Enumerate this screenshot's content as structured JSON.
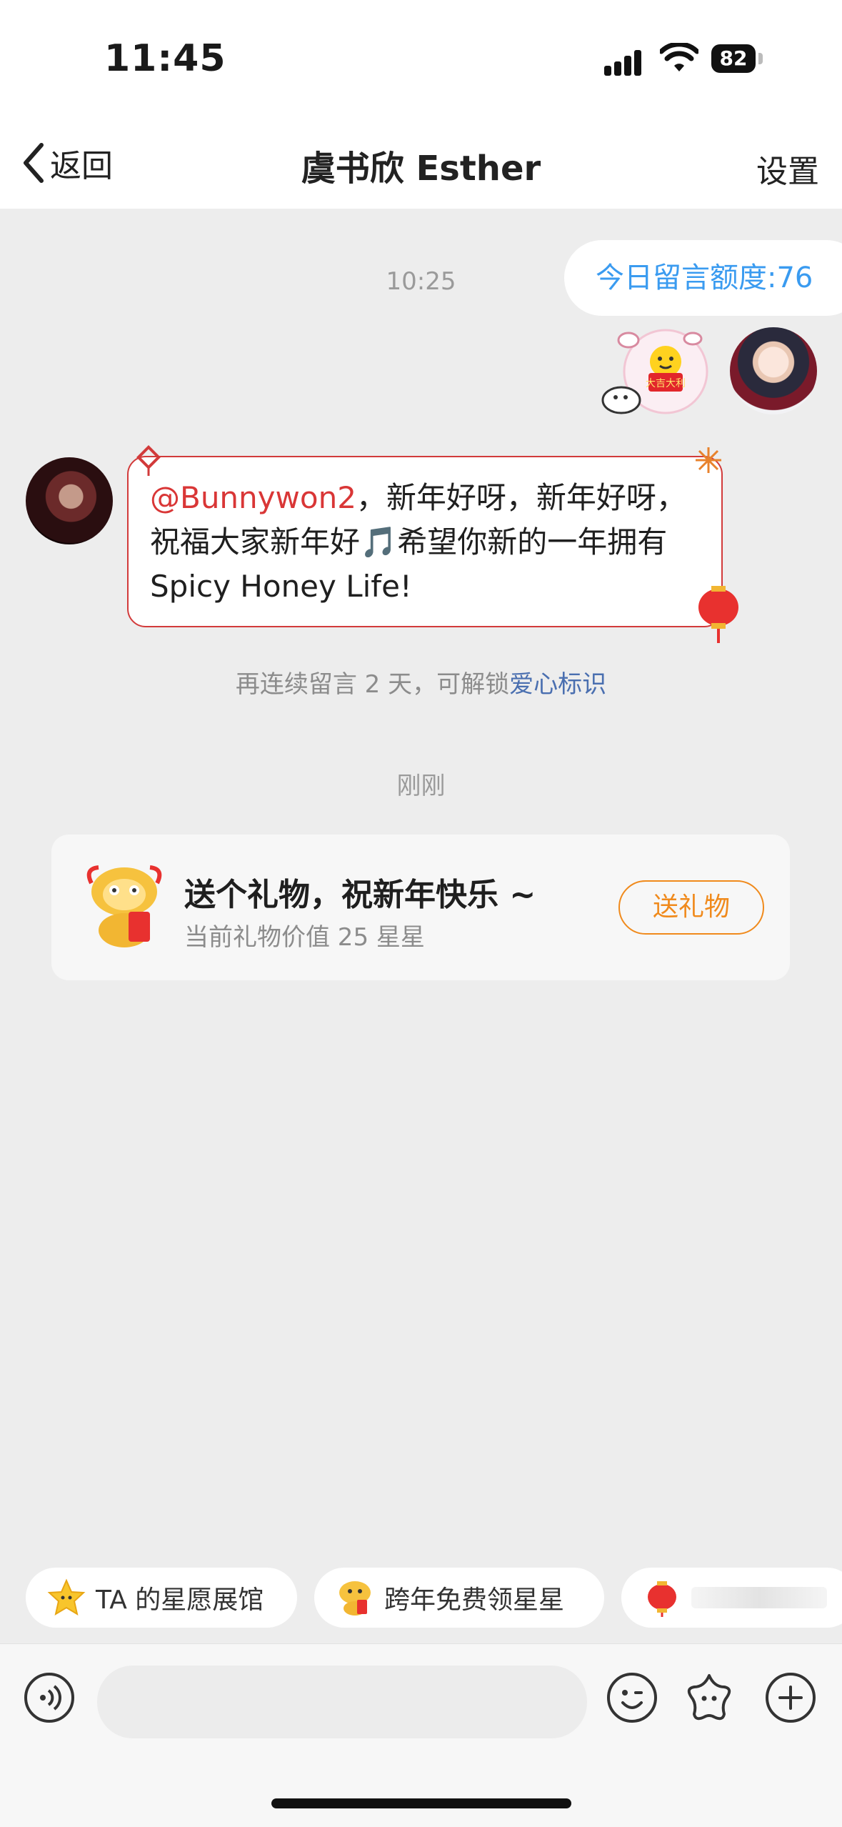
{
  "status_bar": {
    "time": "11:45",
    "battery": "82"
  },
  "nav": {
    "back_label": "返回",
    "title": "虞书欣 Esther",
    "settings_label": "设置"
  },
  "chat": {
    "timestamp_1": "10:25",
    "quota_label": "今日留言额度:76",
    "message": {
      "mention": "@Bunnywon2",
      "text": "，新年好呀，新年好呀，祝福大家新年好🎵希望你新的一年拥有 Spicy Honey Life!"
    },
    "streak_hint": {
      "prefix": "再连续留言 2 天，可解锁",
      "link": "爱心标识"
    },
    "sticker_text": "大吉大利",
    "timestamp_2": "刚刚"
  },
  "gift_card": {
    "title": "送个礼物，祝新年快乐 ~",
    "subtitle": "当前礼物价值 25 星星",
    "button_label": "送礼物"
  },
  "quick_chips": [
    {
      "label": "TA 的星愿展馆",
      "icon": "star-face-icon"
    },
    {
      "label": "跨年免费领星星",
      "icon": "lion-dance-icon"
    },
    {
      "label": "",
      "icon": "lantern-icon"
    }
  ],
  "input_bar": {
    "voice_icon": "voice-icon",
    "emoji_icon": "emoji-icon",
    "star_icon": "star-gift-icon",
    "plus_icon": "plus-icon"
  },
  "colors": {
    "accent_blue": "#3a9bf0",
    "mention_red": "#d93636",
    "gift_orange": "#f08a1c",
    "link_blue": "#4a6fb0"
  }
}
